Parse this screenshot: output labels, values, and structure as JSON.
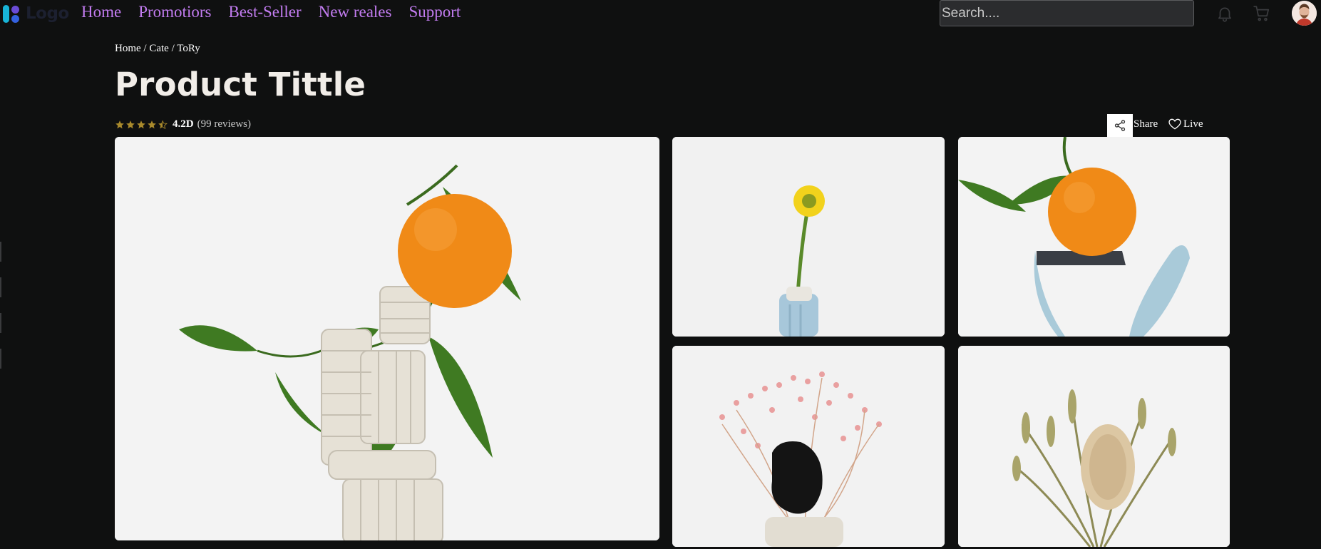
{
  "header": {
    "logo_text": "Logo",
    "nav": [
      {
        "label": "Home"
      },
      {
        "label": "Promotiors"
      },
      {
        "label": "Best-Seller"
      },
      {
        "label": "New reales"
      },
      {
        "label": "Support"
      }
    ],
    "search_placeholder": "Search....",
    "icons": [
      "bell-icon",
      "cart-icon",
      "avatar"
    ]
  },
  "breadcrumb": {
    "items": [
      "Home",
      "Cate",
      "ToRy"
    ],
    "separator": " / "
  },
  "product": {
    "title": "Product Tittle",
    "rating_value": "4.2D",
    "rating_count": "(99 reviews)",
    "stars": 4.5,
    "star_color": "#c9a227",
    "share_label": "Share",
    "live_label": "Live"
  },
  "gallery": {
    "images": [
      {
        "name": "orange-on-ceramic-sculpture"
      },
      {
        "name": "yellow-flower-in-blue-vase"
      },
      {
        "name": "orange-on-blue-sculpture"
      },
      {
        "name": "pink-dried-flowers-black-rock"
      },
      {
        "name": "dried-banksia-bouquet"
      }
    ]
  },
  "colors": {
    "background": "#0f1010",
    "nav_link": "#c27cf0",
    "title": "#f1ede8"
  }
}
